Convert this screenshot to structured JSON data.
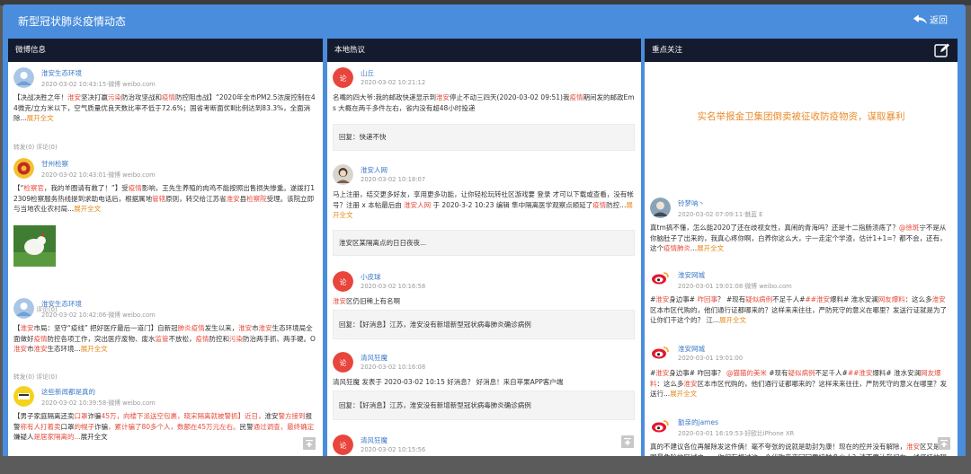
{
  "app": {
    "title": "新型冠状肺炎疫情动态",
    "back_label": "返回"
  },
  "columns": [
    {
      "header": "微博信息"
    },
    {
      "header": "本地热议"
    },
    {
      "header": "重点关注"
    }
  ],
  "weibo": [
    {
      "user": "淮安生态环境",
      "time": "2020-03-02 10:43:15·微博 weibo.com",
      "t": [
        "【决战决胜之年！",
        "淮安",
        "坚决打赢",
        "污染",
        "防治攻坚战和",
        "疫情",
        "防控阻击战】“2020年全市PM2.5浓度控制在44微克/立方米以下，空气质量优良天数比率不低于72.6%；国省考断面优Ⅲ比例达到83.3%，全面消除...",
        "展开全文"
      ],
      "meta": "转发(0)  评论(0)"
    },
    {
      "user": "甘州检察",
      "time": "2020-03-02 10:43:01·微博 weibo.com",
      "t": [
        "【“",
        "检察官",
        "，我的羊圈请有救了！”】受",
        "疫情",
        "影响，王先生养殖的肉鸡不能按照出售损失惨重。遂拨打12309检察服务热线提到求助电话后，根据属地",
        "管辖",
        "原则，转交给江苏省",
        "淮安",
        "县",
        "检察院",
        "受理。该院立即与当地农业农村局...",
        "展开全文"
      ],
      "meta": "转发(0)  评论(0)"
    },
    {
      "user": "淮安生态环境",
      "time": "2020-03-02 10:42:06·微博 weibo.com",
      "t": [
        "【",
        "淮安",
        "市局：坚守“疫线” 把好医疗最后一道门】自新冠",
        "肺炎疫情",
        "发生以来，",
        "淮安",
        "市",
        "淮安",
        "生态环境局全面做好",
        "疫情",
        "防控各项工作，突出医疗废物、废水",
        "监管",
        "不放松，",
        "疫情",
        "防控和",
        "污染",
        "防治两手抓、两手硬。O",
        "淮安",
        "市",
        "淮安",
        "生态环境...",
        "展开全文"
      ],
      "meta": "转发(0)  评论(0)"
    },
    {
      "user": "这些新闻都是真的",
      "time": "2020-03-02 10:39:58·微博 weibo.com",
      "t": [
        "【男子家庭隔离还卖",
        "口罩",
        "诈骗",
        "45万，向楼下派送空包裹，晓宋隔离就被警抓】近日，",
        "淮安",
        "警方接到",
        "报警",
        "称有人打着卖",
        "口罩",
        "的幌子",
        "诈骗",
        "，累计骗了80多个人，数额在45万元左右。",
        "民警",
        "通过调查，最终确定",
        "嫌疑人",
        "是居家隔离的...",
        "展开全文"
      ],
      "meta": "转发(0)  评论(0)"
    }
  ],
  "hot": [
    {
      "user": "山丘",
      "time": "2020-03-02 10:21:12",
      "t": [
        "名嘴的四大爷:我的邮政快递显示到",
        "淮安",
        "停止不动三四天(2020-03-02 09:51)我",
        "疫情",
        "期间发的邮政Ems 大概在两千多件左右，省内没有超48小时投递"
      ],
      "reply": "回复：快递不快"
    },
    {
      "user": "淮安人网",
      "time": "2020-03-02 10:18:07",
      "t": [
        "马上注册，结交更多好友，享用更多功能，让你轻松玩转社区游戏要 登录 才可以下载或查看，没有帐号？注册 x 本帖最后由 ",
        "淮安人网",
        " 于 2020-3-2 10:23 编辑 隼中隔离医学观察点顺延了",
        "疫情",
        "防控...",
        "展开全文"
      ],
      "reply": "淮安区某隔离点的日日夜夜..."
    },
    {
      "user": "小皮球",
      "time": "2020-03-02 10:16:58",
      "t": [
        "淮安",
        "区仍旧稀上有名啊"
      ],
      "reply": "回复：【好消息】江苏，淮安没有新增新型冠状病毒肺炎确诊病例"
    },
    {
      "user": "清风狂魔",
      "time": "2020-03-02 10:16:08",
      "t": [
        "清风狂魔 发表于 2020-03-02 10:15 好消息？ 好消息！来自苹果APP客户端"
      ],
      "reply": "回复：【好消息】江苏，淮安没有新增新型冠状病毒肺炎确诊病例"
    },
    {
      "user": "清风狂魔",
      "time": "2020-03-02 10:15:56"
    }
  ],
  "focus": {
    "notice": "实名举报金卫集团倒卖被征收防疫物资，谋取暴利",
    "posts": [
      {
        "user": "铃梦呐丶",
        "time": "2020-03-02 07:09:11·魅蓝 E",
        "t": [
          "真tm搞不懂，怎么能2020了还在歧视女性，真闹的青海吗？还是十二指肠溃疡了？",
          "@徐斑",
          "宁不是从你脑肚子了出来的，我真心疼你啊，白养你这么大，宁一走定个学渣，估计1+1=？都不会，还有，这个",
          "疫情",
          "肺炎",
          "...",
          "展开全文"
        ]
      },
      {
        "user": "淮安网城",
        "time": "2020-03-01 19:01:08·微博 weibo.com",
        "t": [
          "#",
          "淮安",
          "身边事# ",
          "咋回事",
          "？ #现有",
          "疑似病例",
          "不足千人#",
          "##淮安",
          "爆料# 淮水安澜",
          "网友爆料",
          "：这么多",
          "淮安",
          "区本市区代购的，他们通行证都哪来的？这样来来往往，严防死守的意义在哪里？发送行证就是为了让你们干这个的？ 江...",
          "展开全文"
        ]
      },
      {
        "user": "淮安网城",
        "time": "2020-03-01 19:01:00",
        "t": [
          "#",
          "淮安",
          "身边事# 咋回事？ ",
          "@猫猫的美米",
          " #现有",
          "疑似病例",
          "不足千人#",
          "##淮安",
          "爆料# 淮水安澜",
          "网友爆料",
          "：这么多",
          "淮安",
          "区本市区代购的，他们通行证都哪来的？这样来来往往，严防死守的意义在哪里？发送行...",
          "展开全文"
        ]
      },
      {
        "user": "勤亲的james",
        "time": "2020-03-01 16:19:53·好欧比iPhone XR",
        "t": [
          "真的不建议各位再解除发这件俩！毫不夸张的说就是助封为康！现在的控并没有解除，",
          "淮安",
          "区又是全国最危险的区域之一，你们有想过这一个代购来来回回要接触多少人？请不要让我们在一线坚持的隔离人员们..."
        ]
      }
    ]
  }
}
